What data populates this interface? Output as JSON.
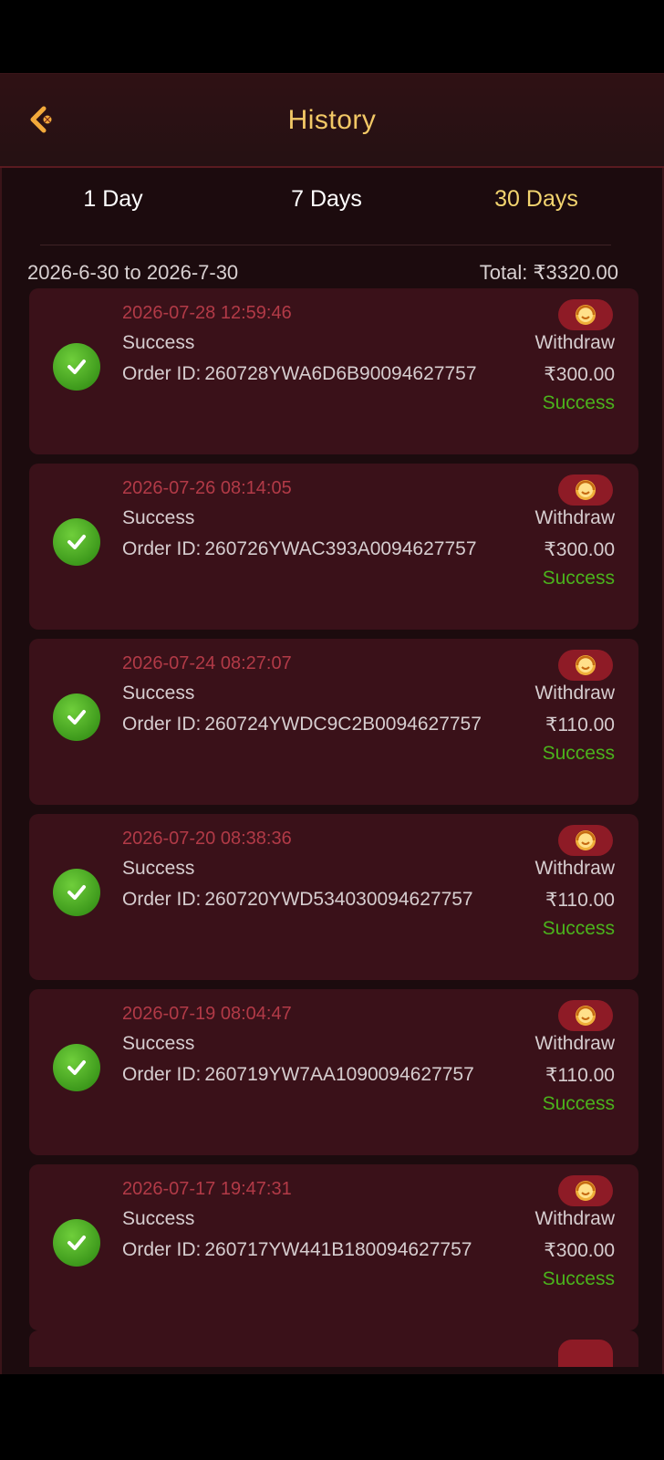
{
  "header": {
    "title": "History"
  },
  "tabs": [
    {
      "label": "1 Day"
    },
    {
      "label": "7 Days"
    },
    {
      "label": "30 Days",
      "active": true
    }
  ],
  "summary": {
    "range": "2026-6-30 to 2026-7-30",
    "total": "Total: ₹3320.00"
  },
  "colors": {
    "accent": "#f2c866",
    "success": "#4bb31c",
    "timestamp": "#b23a47",
    "card": "#3a1119"
  },
  "records": [
    {
      "time": "2026-07-28 12:59:46",
      "status": "Success",
      "order_label": "Order ID:",
      "order_id": "260728YWA6D6B90094627757",
      "type": "Withdraw",
      "amount": "₹300.00",
      "result": "Success"
    },
    {
      "time": "2026-07-26 08:14:05",
      "status": "Success",
      "order_label": "Order ID:",
      "order_id": "260726YWAC393A0094627757",
      "type": "Withdraw",
      "amount": "₹300.00",
      "result": "Success"
    },
    {
      "time": "2026-07-24 08:27:07",
      "status": "Success",
      "order_label": "Order ID:",
      "order_id": "260724YWDC9C2B0094627757",
      "type": "Withdraw",
      "amount": "₹110.00",
      "result": "Success"
    },
    {
      "time": "2026-07-20 08:38:36",
      "status": "Success",
      "order_label": "Order ID:",
      "order_id": "260720YWD534030094627757",
      "type": "Withdraw",
      "amount": "₹110.00",
      "result": "Success"
    },
    {
      "time": "2026-07-19 08:04:47",
      "status": "Success",
      "order_label": "Order ID:",
      "order_id": "260719YW7AA1090094627757",
      "type": "Withdraw",
      "amount": "₹110.00",
      "result": "Success"
    },
    {
      "time": "2026-07-17 19:47:31",
      "status": "Success",
      "order_label": "Order ID:",
      "order_id": "260717YW441B180094627757",
      "type": "Withdraw",
      "amount": "₹300.00",
      "result": "Success"
    }
  ]
}
